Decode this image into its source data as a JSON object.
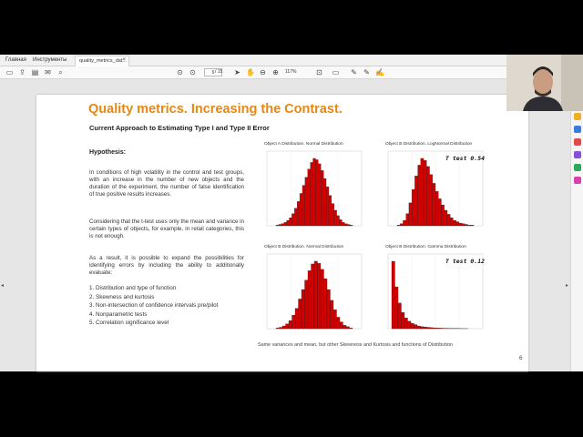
{
  "browser": {
    "menu": [
      "Главная",
      "Инструменты"
    ],
    "tab_title": "quality_metrics_dat...",
    "tab_close": "×"
  },
  "toolbar": {
    "page_current": "6",
    "page_total": "/ 15",
    "zoom": "117%"
  },
  "slide": {
    "title": "Quality metrics. Increasing the Contrast.",
    "subtitle": "Current Approach to Estimating Type I and Type II Error",
    "hypothesis_label": "Hypothesis:",
    "para1": "In conditions of high volatility in the control and test groups, with an increase in the number of new objects and the duration of the experiment, the number of false identification of true positive results increases.",
    "para2": "Considering that the t-test uses only the mean and variance in certain types of objects, for example, in retail categories, this is not enough.",
    "para3": "As a result, it is possible to expand the possibilities for identifying errors by including the ability to additionally evaluate:",
    "list": [
      "1.  Distribution and type of function",
      "2.  Skewness and kurtosis",
      "3.  Non-intersection of confidence intervals pre/pilot",
      "4.  Nonparametric tests",
      "5.  Correlation significance level"
    ],
    "caption": "Same variances and mean, but other Skewness and Kurtosis and functions of Distribution",
    "page_number": "6"
  },
  "charts": {
    "colors": {
      "bar": "#d40000",
      "bar_edge": "#222222",
      "panel": "#ffffff",
      "grid": "#eeeeee"
    },
    "a_title": "Object A Distribution. Normal Distribution",
    "b1_title": "Object B Distribution. LogNormal Distribution",
    "c_title": "Object B Distribution. Normal Distribution",
    "d_title": "Object B Distribution. Gamma Distribution",
    "ttest_top": "T test 0.54",
    "ttest_bottom": "T test 0.12"
  },
  "chart_data": [
    {
      "type": "bar",
      "title": "Object A Distribution. Normal Distribution",
      "values": [
        1,
        2,
        3,
        5,
        8,
        12,
        18,
        26,
        36,
        48,
        60,
        72,
        84,
        94,
        100,
        98,
        92,
        82,
        70,
        58,
        45,
        33,
        23,
        15,
        9,
        5,
        3,
        2,
        1
      ]
    },
    {
      "type": "bar",
      "title": "Object B Distribution. LogNormal Distribution",
      "values": [
        1,
        3,
        8,
        18,
        34,
        54,
        74,
        90,
        100,
        97,
        88,
        76,
        63,
        51,
        40,
        31,
        23,
        17,
        12,
        8,
        6,
        4,
        3,
        2,
        1,
        1
      ]
    },
    {
      "type": "bar",
      "title": "Object B Distribution. Normal Distribution",
      "values": [
        1,
        2,
        4,
        7,
        12,
        20,
        30,
        44,
        58,
        72,
        86,
        96,
        100,
        97,
        88,
        74,
        58,
        42,
        28,
        17,
        10,
        5,
        3,
        1
      ]
    },
    {
      "type": "bar",
      "title": "Object B Distribution. Gamma Distribution",
      "values": [
        100,
        62,
        38,
        24,
        16,
        11,
        8,
        6,
        4,
        3,
        2.5,
        2,
        1.5,
        1.2,
        1,
        0.8,
        0.6,
        0.5,
        0.4,
        0.3,
        0.25,
        0.2,
        0.15,
        0.1
      ]
    }
  ]
}
